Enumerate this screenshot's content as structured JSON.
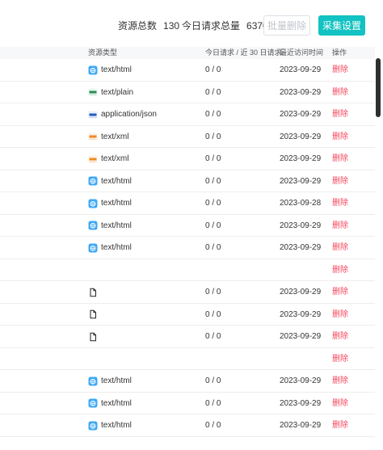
{
  "stats": {
    "total_label": "资源总数",
    "total_value": "130",
    "today_label": "今日请求总量",
    "today_value": "6370"
  },
  "buttons": {
    "batch_delete": "批量删除",
    "collect_settings": "采集设置"
  },
  "table": {
    "headers": {
      "type": "资源类型",
      "requests": "今日请求 / 近 30 日请求",
      "last_access": "最近访问时间",
      "action": "操作"
    },
    "rows": [
      {
        "icon": "html-file-icon",
        "type": "text/html",
        "requests": "0 / 0",
        "last": "2023-09-29",
        "action": "删除"
      },
      {
        "icon": "txt-file-icon",
        "type": "text/plain",
        "requests": "0 / 0",
        "last": "2023-09-29",
        "action": "删除"
      },
      {
        "icon": "json-file-icon",
        "type": "application/json",
        "requests": "0 / 0",
        "last": "2023-09-29",
        "action": "删除"
      },
      {
        "icon": "xml-file-icon",
        "type": "text/xml",
        "requests": "0 / 0",
        "last": "2023-09-29",
        "action": "删除"
      },
      {
        "icon": "xml-file-icon",
        "type": "text/xml",
        "requests": "0 / 0",
        "last": "2023-09-29",
        "action": "删除"
      },
      {
        "icon": "html-file-icon",
        "type": "text/html",
        "requests": "0 / 0",
        "last": "2023-09-29",
        "action": "删除"
      },
      {
        "icon": "html-file-icon",
        "type": "text/html",
        "requests": "0 / 0",
        "last": "2023-09-28",
        "action": "删除"
      },
      {
        "icon": "html-file-icon",
        "type": "text/html",
        "requests": "0 / 0",
        "last": "2023-09-29",
        "action": "删除"
      },
      {
        "icon": "html-file-icon",
        "type": "text/html",
        "requests": "0 / 0",
        "last": "2023-09-29",
        "action": "删除"
      },
      {
        "icon": "",
        "type": "",
        "requests": "",
        "last": "",
        "action": "删除"
      },
      {
        "icon": "blank-file-icon",
        "type": "",
        "requests": "0 / 0",
        "last": "2023-09-29",
        "action": "删除"
      },
      {
        "icon": "blank-file-icon",
        "type": "",
        "requests": "0 / 0",
        "last": "2023-09-29",
        "action": "删除"
      },
      {
        "icon": "blank-file-icon",
        "type": "",
        "requests": "0 / 0",
        "last": "2023-09-29",
        "action": "删除"
      },
      {
        "icon": "",
        "type": "",
        "requests": "",
        "last": "",
        "action": "删除"
      },
      {
        "icon": "html-file-icon",
        "type": "text/html",
        "requests": "0 / 0",
        "last": "2023-09-29",
        "action": "删除"
      },
      {
        "icon": "html-file-icon",
        "type": "text/html",
        "requests": "0 / 0",
        "last": "2023-09-29",
        "action": "删除"
      },
      {
        "icon": "html-file-icon",
        "type": "text/html",
        "requests": "0 / 0",
        "last": "2023-09-29",
        "action": "删除"
      }
    ]
  },
  "colors": {
    "accent": "#13c2c2",
    "danger": "#f5475d",
    "header_bg": "#f7f8fa"
  }
}
